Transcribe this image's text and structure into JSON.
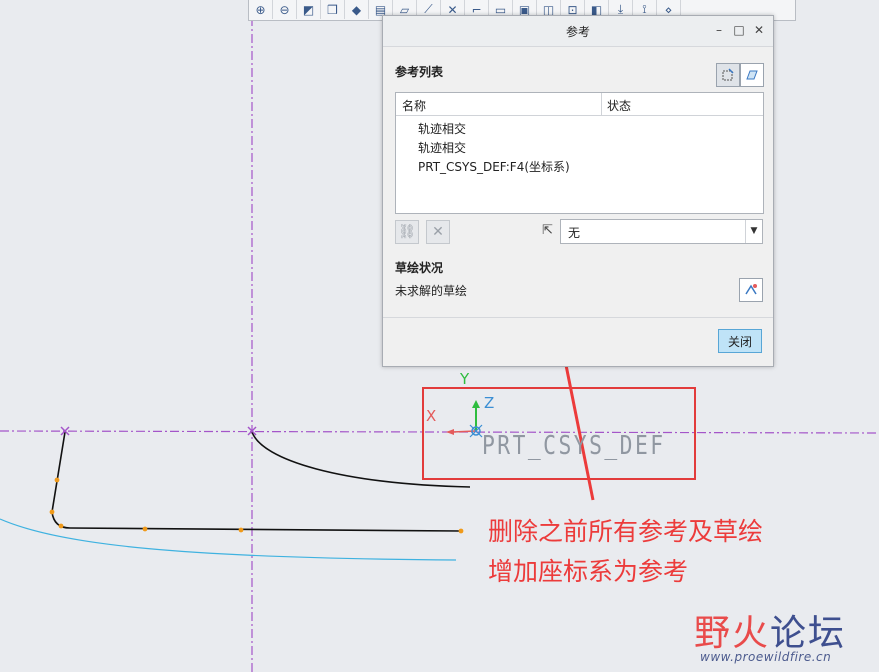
{
  "toolbar": {
    "icons": [
      "zoom-in-icon",
      "zoom-out-icon",
      "repaint-icon",
      "view-cube-icon",
      "saved-views-icon",
      "layers-icon",
      "datum-plane-icon",
      "datum-axis-icon",
      "datum-point-icon",
      "csys-icon",
      "sketch-icon",
      "annotation-icon",
      "spin-center-icon",
      "tangent-icon",
      "display-style-icon",
      "orient-icon",
      "reference-icon",
      "references-icon"
    ]
  },
  "dialog": {
    "title": "参考",
    "ref_list_label": "参考列表",
    "columns": {
      "name": "名称",
      "status": "状态"
    },
    "rows": [
      {
        "name": "轨迹相交"
      },
      {
        "name": "轨迹相交"
      },
      {
        "name": "PRT_CSYS_DEF:F4(坐标系)"
      }
    ],
    "filter_select": {
      "value": "无"
    },
    "sketch_status_label": "草绘状况",
    "sketch_status_value": "未求解的草绘",
    "close_button": "关闭"
  },
  "canvas": {
    "csys_name": "PRT_CSYS_DEF",
    "axis_x": "X",
    "axis_y": "Y",
    "axis_z": "Z"
  },
  "annotation": {
    "line1": "删除之前所有参考及草绘",
    "line2": "增加座标系为参考",
    "color": "#ec3b3b"
  },
  "watermark": {
    "brand_part1": "野火",
    "brand_part2": "论坛",
    "url": "www.proewildfire.cn"
  }
}
